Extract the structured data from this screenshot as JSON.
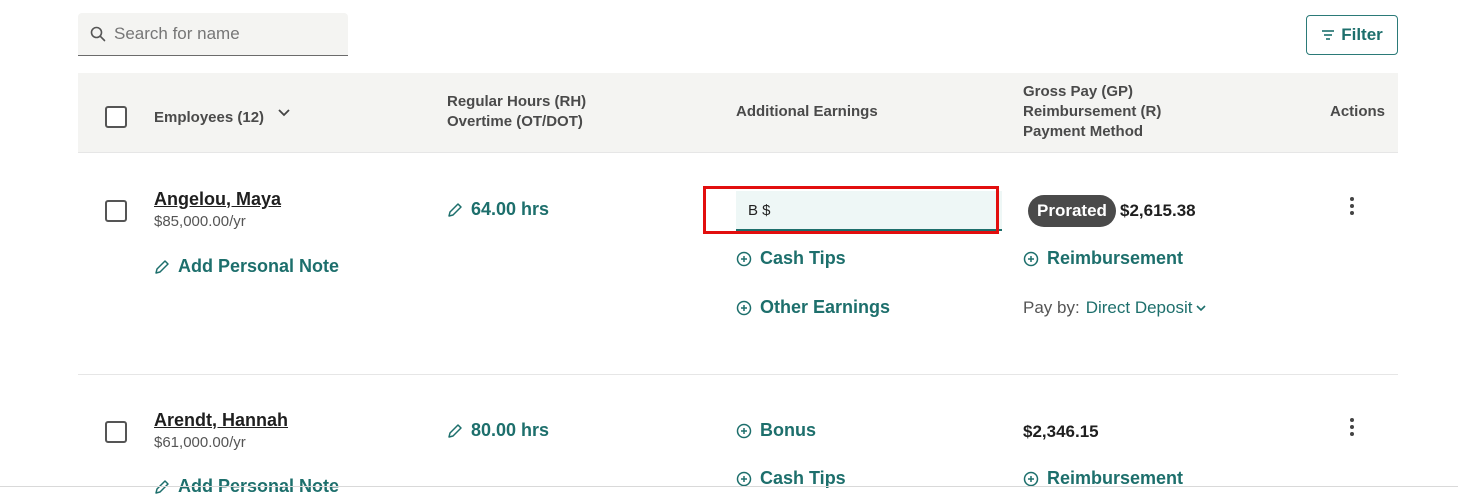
{
  "search": {
    "placeholder": "Search for name",
    "value": ""
  },
  "filter": {
    "label": "Filter"
  },
  "table_header": {
    "employees": "Employees (12)",
    "hours_line1": "Regular Hours (RH)",
    "hours_line2": "Overtime (OT/DOT)",
    "additional": "Additional Earnings",
    "gross_line1": "Gross Pay (GP)",
    "gross_line2": "Reimbursement (R)",
    "gross_line3": "Payment Method",
    "actions": "Actions"
  },
  "rows": [
    {
      "name": "Angelou, Maya",
      "salary": "$85,000.00/yr",
      "note_label": "Add Personal Note",
      "hours": "64.00 hrs",
      "earning_input": "B $",
      "earnings": [
        "Cash Tips",
        "Other Earnings"
      ],
      "badge": "Prorated",
      "gross": "$2,615.38",
      "reimbursement": "Reimbursement",
      "payby_label": "Pay by:",
      "payby_method": "Direct Deposit"
    },
    {
      "name": "Arendt, Hannah",
      "salary": "$61,000.00/yr",
      "note_label": "Add Personal Note",
      "hours": "80.00 hrs",
      "earnings": [
        "Bonus",
        "Cash Tips"
      ],
      "gross": "$2,346.15",
      "reimbursement": "Reimbursement"
    }
  ],
  "colors": {
    "accent": "#1d6f6c",
    "highlight": "#e20e0e",
    "badge": "#4a4a4a"
  }
}
